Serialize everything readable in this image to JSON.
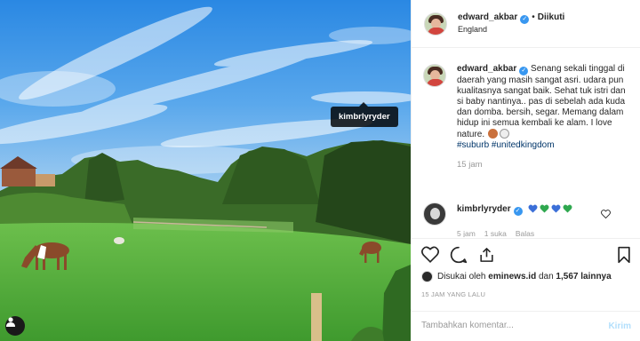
{
  "photo": {
    "tooltip_tag": "kimbrlyryder",
    "user_tag_icon": "user-silhouette-icon"
  },
  "header": {
    "username": "edward_akbar",
    "separator": "•",
    "follow_status": "Diikuti",
    "location": "England"
  },
  "caption": {
    "username": "edward_akbar",
    "text": "Senang sekali tinggal di daerah yang masih sangat asri. udara pun kualitasnya sangat baik. Sehat tuk istri dan si baby nantinya.. pas di sebelah ada kuda dan domba. bersih, segar. Memang dalam hidup ini semua kembali ke alam. I love nature.",
    "hashtags": "#suburb #unitedkingdom",
    "time": "15 jam"
  },
  "comment": {
    "username": "kimbrlyryder",
    "heart_colors": [
      "#3b6fd8",
      "#2fa84f",
      "#3b6fd8",
      "#2fa84f"
    ],
    "time": "5 jam",
    "likes": "1 suka",
    "reply": "Balas"
  },
  "actions": {
    "icons": [
      "heart-icon",
      "comment-icon",
      "share-icon",
      "bookmark-icon"
    ]
  },
  "likes": {
    "prefix": "Disukai oleh",
    "user": "eminews.id",
    "connector": "dan",
    "others": "1,567 lainnya"
  },
  "timestamp": "15 JAM YANG LALU",
  "add_comment": {
    "placeholder": "Tambahkan komentar...",
    "post_label": "Kirim"
  },
  "colors": {
    "sky_top": "#2d8ee6",
    "grass": "#4ea93a",
    "verified": "#3897f0",
    "hashtag": "#003569",
    "post_disabled": "#b2dffc"
  }
}
